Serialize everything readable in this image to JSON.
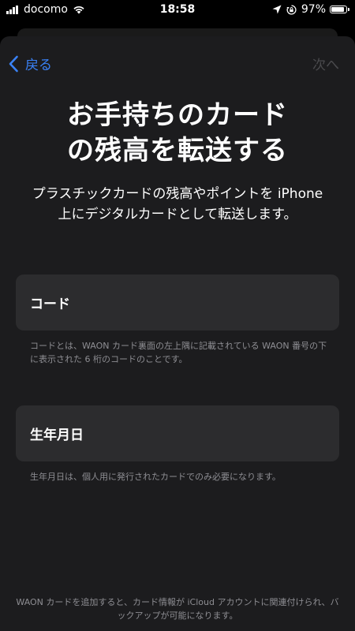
{
  "status_bar": {
    "carrier": "docomo",
    "time": "18:58",
    "battery_percent": "97%",
    "battery_level": 0.97,
    "icons": [
      "signal-icon",
      "wifi-icon",
      "location-icon",
      "orientation-lock-icon",
      "battery-icon"
    ]
  },
  "nav": {
    "back_label": "戻る",
    "next_label": "次へ"
  },
  "title": "お手持ちのカード\nの残高を転送する",
  "subtitle": "プラスチックカードの残高やポイントを iPhone 上にデジタルカードとして転送します。",
  "fields": {
    "code": {
      "label": "コード",
      "note": "コードとは、WAON カード裏面の左上隅に記載されている WAON 番号の下に表示された 6 桁のコードのことです。"
    },
    "dob": {
      "label": "生年月日",
      "note": "生年月日は、個人用に発行されたカードでのみ必要になります。"
    }
  },
  "footer": "WAON カードを追加すると、カード情報が iCloud アカウントに関連付けられ、バックアップが可能になります。",
  "colors": {
    "accent": "#3a82f7",
    "disabled": "#4a4a4d",
    "sheet_bg": "#1c1c1e",
    "field_bg": "#2c2c2e",
    "secondary_text": "#8e8e93"
  }
}
